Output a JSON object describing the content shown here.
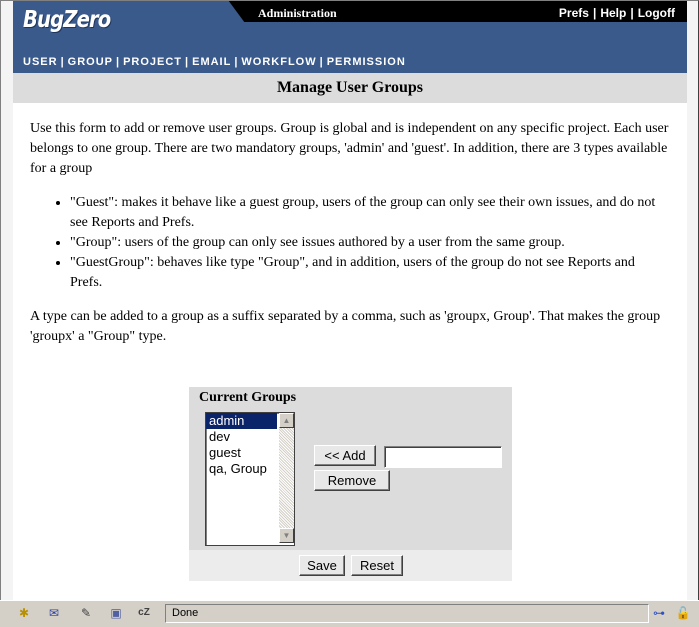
{
  "header": {
    "logo_text": "BugZero",
    "section_title": "Administration",
    "links": [
      "Prefs",
      "Help",
      "Logoff"
    ],
    "nav": [
      "USER",
      "GROUP",
      "PROJECT",
      "EMAIL",
      "WORKFLOW",
      "PERMISSION"
    ],
    "colors": {
      "bar": "#3a5a8c",
      "top": "#000000"
    }
  },
  "page": {
    "title": "Manage User Groups",
    "intro": "Use this form to add or remove user groups. Group is global and is independent on any specific project. Each user belongs to one group. There are two mandatory groups, 'admin' and 'guest'. In addition, there are 3 types available for a group",
    "bullets": [
      "\"Guest\": makes it behave like a guest group, users of the group can only see their own issues, and do not see Reports and Prefs.",
      "\"Group\": users of the group can only see issues authored by a user from the same group.",
      "\"GuestGroup\": behaves like type \"Group\", and in addition, users of the group do not see Reports and Prefs."
    ],
    "note": "A type can be added to a group as a suffix separated by a comma, such as 'groupx, Group'. That makes the group 'groupx' a \"Group\" type."
  },
  "groups_form": {
    "title": "Current Groups",
    "groups": [
      "admin",
      "dev",
      "guest",
      "qa, Group"
    ],
    "selected": "admin",
    "add_label": "<< Add",
    "remove_label": "Remove",
    "new_group_value": "",
    "save_label": "Save",
    "reset_label": "Reset"
  },
  "statusbar": {
    "text": "Done",
    "icons": [
      "network-icon",
      "mail-icon",
      "composer-icon",
      "address-book-icon",
      "irc-icon"
    ]
  }
}
